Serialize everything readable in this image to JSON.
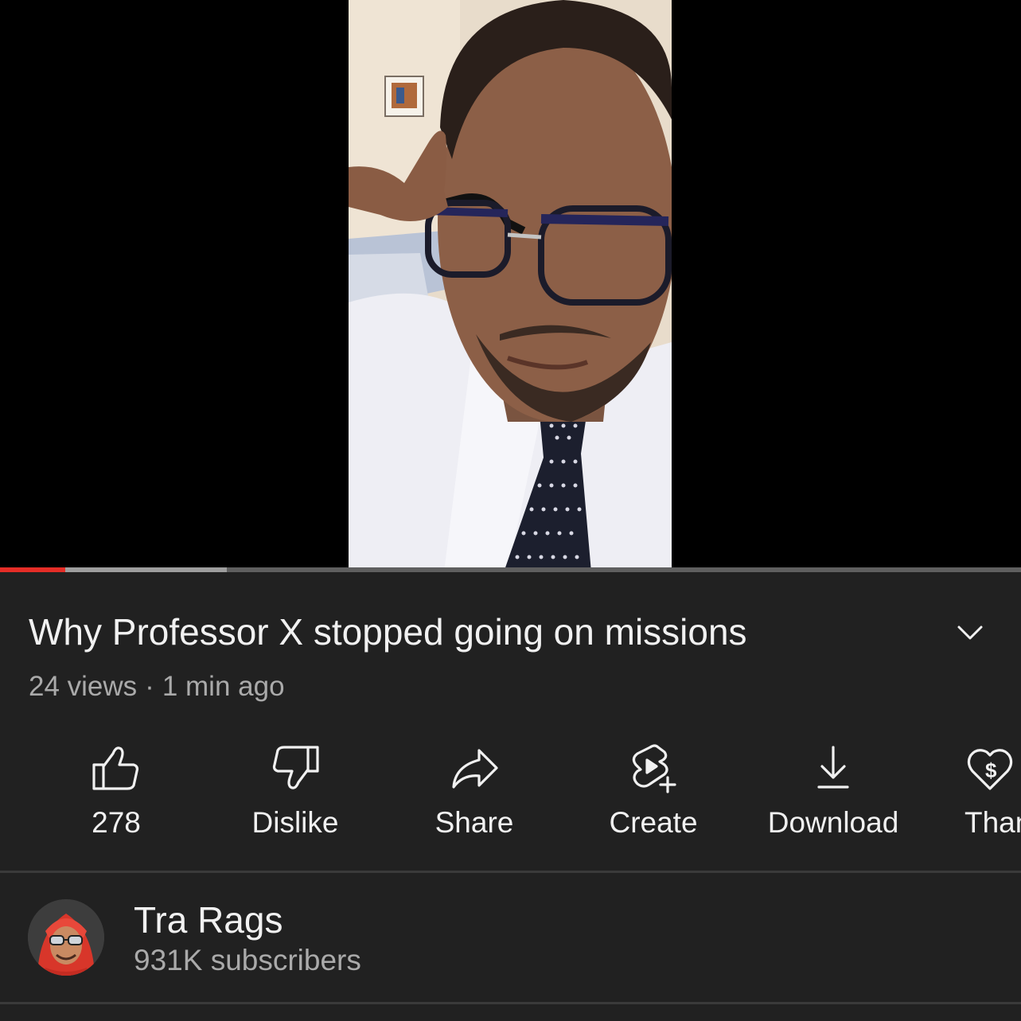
{
  "video": {
    "progress_played": 0.064,
    "progress_buffered": 0.222,
    "progress_color": "#e52d27"
  },
  "title": "Why Professor X stopped going on missions",
  "meta": {
    "views": "24 views",
    "separator": "·",
    "age": "1 min ago"
  },
  "actions": [
    {
      "icon": "thumbs-up-icon",
      "label": "278"
    },
    {
      "icon": "thumbs-down-icon",
      "label": "Dislike"
    },
    {
      "icon": "share-arrow-icon",
      "label": "Share"
    },
    {
      "icon": "create-remix-icon",
      "label": "Create"
    },
    {
      "icon": "download-icon",
      "label": "Download"
    },
    {
      "icon": "thanks-heart-icon",
      "label": "Thanks"
    }
  ],
  "channel": {
    "name": "Tra Rags",
    "subscribers": "931K subscribers"
  },
  "colors": {
    "background": "#212121",
    "text_primary": "#f1f1f1",
    "text_secondary": "#aaaaaa",
    "accent": "#e52d27"
  }
}
